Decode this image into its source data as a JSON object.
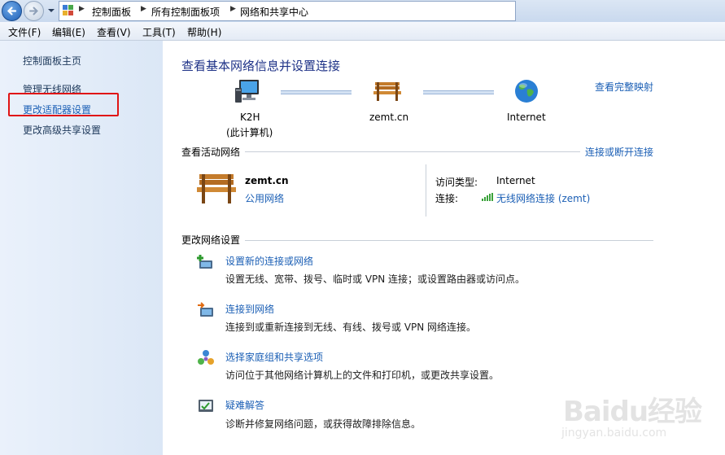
{
  "breadcrumb": [
    "控制面板",
    "所有控制面板项",
    "网络和共享中心"
  ],
  "menu": [
    "文件(F)",
    "编辑(E)",
    "查看(V)",
    "工具(T)",
    "帮助(H)"
  ],
  "sidebar": {
    "items": [
      "控制面板主页",
      "管理无线网络",
      "更改适配器设置",
      "更改高级共享设置"
    ]
  },
  "main": {
    "title": "查看基本网络信息并设置连接",
    "view_full_map": "查看完整映射",
    "map": {
      "computer_name": "K2H",
      "computer_sub": "(此计算机)",
      "network_name": "zemt.cn",
      "internet": "Internet"
    },
    "active_section": {
      "heading": "查看活动网络",
      "link": "连接或断开连接",
      "network_name": "zemt.cn",
      "network_type": "公用网络",
      "access_type_label": "访问类型:",
      "access_type_value": "Internet",
      "connection_label": "连接:",
      "connection_value": "无线网络连接 (zemt)"
    },
    "change_section": {
      "heading": "更改网络设置",
      "tasks": [
        {
          "title": "设置新的连接或网络",
          "desc": "设置无线、宽带、拨号、临时或 VPN 连接；或设置路由器或访问点。"
        },
        {
          "title": "连接到网络",
          "desc": "连接到或重新连接到无线、有线、拨号或 VPN 网络连接。"
        },
        {
          "title": "选择家庭组和共享选项",
          "desc": "访问位于其他网络计算机上的文件和打印机，或更改共享设置。"
        },
        {
          "title": "疑难解答",
          "desc": "诊断并修复网络问题，或获得故障排除信息。"
        }
      ]
    }
  },
  "watermark": {
    "brand": "Baidu经验",
    "url": "jingyan.baidu.com"
  },
  "colors": {
    "link": "#1b5fb5",
    "title": "#1e3287",
    "highlight": "#e01414",
    "sidebar_bg": "#dbe7f6"
  }
}
